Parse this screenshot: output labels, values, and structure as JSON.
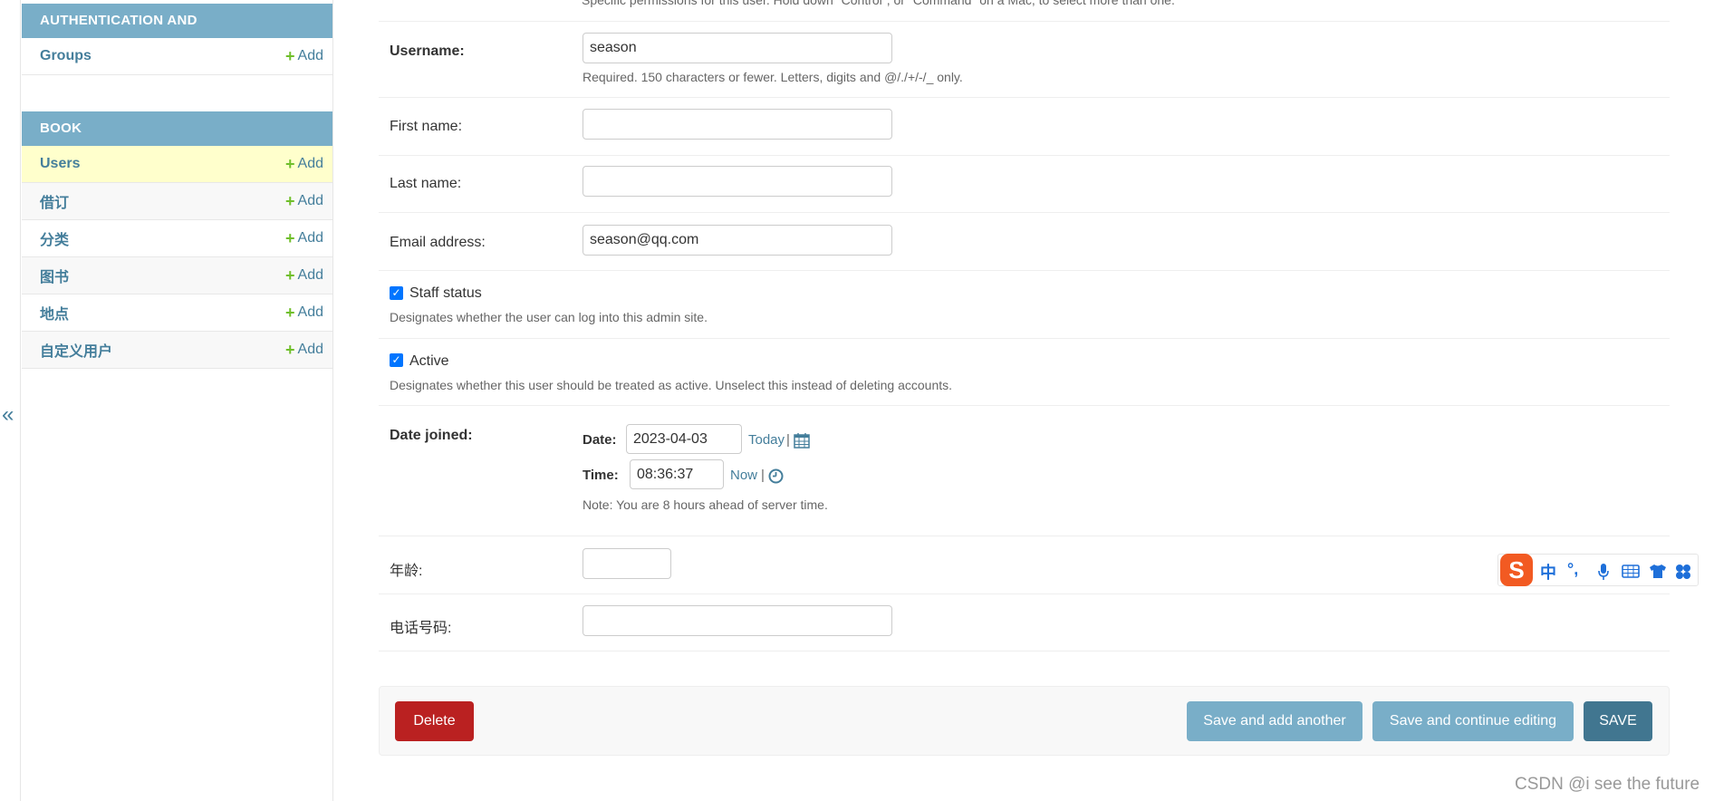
{
  "sidebar": {
    "collapse_label": "«",
    "modules": [
      {
        "caption": "AUTHENTICATION AND AUTHORIZATION",
        "models": [
          {
            "name": "Groups",
            "add_label": "Add"
          }
        ]
      },
      {
        "caption": "BOOK",
        "models": [
          {
            "name": "Users",
            "add_label": "Add",
            "current": true
          },
          {
            "name": "借订",
            "add_label": "Add"
          },
          {
            "name": "分类",
            "add_label": "Add"
          },
          {
            "name": "图书",
            "add_label": "Add"
          },
          {
            "name": "地点",
            "add_label": "Add"
          },
          {
            "name": "自定义用户",
            "add_label": "Add"
          }
        ]
      }
    ]
  },
  "form": {
    "top_help": "Specific permissions for this user. Hold down \"Control\", or \"Command\" on a Mac, to select more than one.",
    "username": {
      "label": "Username:",
      "value": "season",
      "help": "Required. 150 characters or fewer. Letters, digits and @/./+/-/_ only."
    },
    "first_name": {
      "label": "First name:",
      "value": ""
    },
    "last_name": {
      "label": "Last name:",
      "value": ""
    },
    "email": {
      "label": "Email address:",
      "value": "season@qq.com"
    },
    "staff_status": {
      "label": "Staff status",
      "checked": true,
      "help": "Designates whether the user can log into this admin site."
    },
    "active": {
      "label": "Active",
      "checked": true,
      "help": "Designates whether this user should be treated as active. Unselect this instead of deleting accounts."
    },
    "date_joined": {
      "label": "Date joined:",
      "date_label": "Date:",
      "date_value": "2023-04-03",
      "today_label": "Today",
      "time_label": "Time:",
      "time_value": "08:36:37",
      "now_label": "Now",
      "separator": "|",
      "note": "Note: You are 8 hours ahead of server time."
    },
    "age": {
      "label": "年龄:",
      "value": ""
    },
    "phone": {
      "label": "电话号码:",
      "value": ""
    }
  },
  "submit_row": {
    "delete_label": "Delete",
    "save_add_label": "Save and add another",
    "save_continue_label": "Save and continue editing",
    "save_label": "SAVE"
  },
  "ime_toolbar": {
    "logo": "S",
    "items": [
      "中",
      "°,",
      "mic-icon",
      "keyboard-icon",
      "shirt-icon",
      "apps-icon"
    ]
  },
  "watermark": "CSDN @i see the future",
  "colors": {
    "module_header": "#79aec8",
    "link": "#447e9b",
    "add_plus": "#70bf2b",
    "current_row": "#ffffcc",
    "delete": "#ba2121",
    "save": "#417690",
    "secondary_button": "#79aec8"
  }
}
